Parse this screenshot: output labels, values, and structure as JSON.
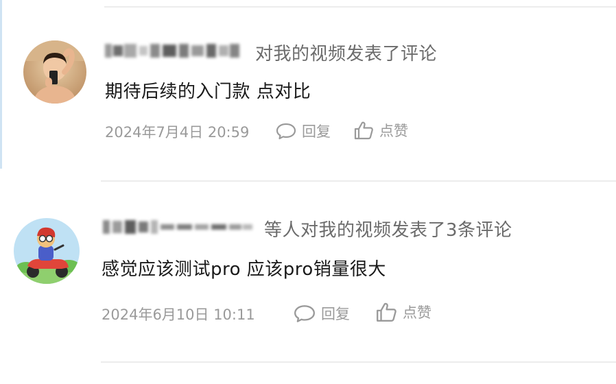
{
  "notifications": [
    {
      "action": "对我的视频发表了评论",
      "comment": "期待后续的入门款   点对比",
      "time": "2024年7月4日 20:59",
      "reply_label": "回复",
      "like_label": "点赞",
      "avatar_icon": "child-selfie-avatar"
    },
    {
      "action": "等人对我的视频发表了3条评论",
      "comment": "感觉应该测试pro 应该pro销量很大",
      "time": "2024年6月10日 10:11",
      "reply_label": "回复",
      "like_label": "点赞",
      "avatar_icon": "cartoon-scooter-avatar"
    }
  ],
  "colors": {
    "action_text": "#6b6b6b",
    "comment_text": "#1a1a1a",
    "meta_text": "#9a9a9a",
    "divider": "#ececec",
    "left_accent": "#cfe3f3"
  }
}
